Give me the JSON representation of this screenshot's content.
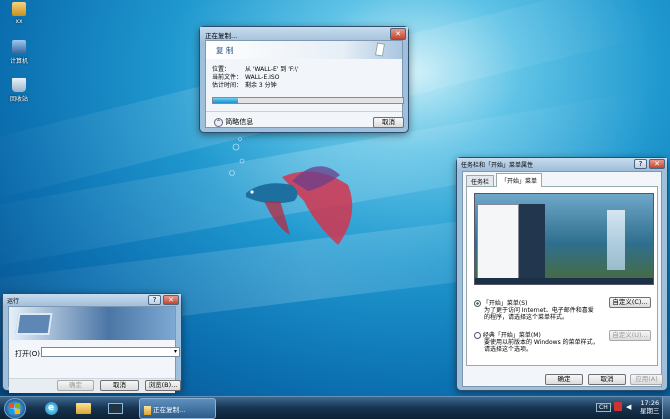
{
  "desktop": {
    "icons": [
      {
        "label": "xx"
      },
      {
        "label": "计算机"
      },
      {
        "label": "回收站"
      }
    ]
  },
  "copy_dialog": {
    "title": "正在复制...",
    "header": "复 制",
    "rows": [
      {
        "label": "位置：",
        "value": "从 'WALL-E' 到 'F:\\'"
      },
      {
        "label": "当前文件：",
        "value": "WALL-E.ISO"
      },
      {
        "label": "估计时间：",
        "value": "剩余 3 分钟"
      }
    ],
    "progress": 0.13,
    "details_label": "简略信息",
    "cancel_label": "取消"
  },
  "run_dialog": {
    "title": "运行",
    "open_label": "打开(O)：",
    "open_value": "",
    "ok_label": "确定",
    "cancel_label": "取消",
    "browse_label": "浏览(B)..."
  },
  "taskbar_props": {
    "title": "任务栏和「开始」菜单属性",
    "tabs": [
      {
        "label": "任务栏"
      },
      {
        "label": "「开始」菜单"
      }
    ],
    "option1": {
      "label": "「开始」菜单(S)",
      "desc1": "为了更于访问 Internet、电子邮件和喜爱",
      "desc2": "的程序，请选择这个菜单样式。",
      "customize": "自定义(C)..."
    },
    "option2": {
      "label": "经典「开始」菜单(M)",
      "desc1": "要使用以前版本的 Windows 的菜单样式，",
      "desc2": "请选择这个选项。",
      "customize": "自定义(U)..."
    },
    "ok_label": "确定",
    "cancel_label": "取消",
    "apply_label": "应用(A)"
  },
  "taskbar": {
    "task_label": "正在复制...",
    "time": "17:26",
    "day": "星期三",
    "lang": "CH"
  },
  "colors": {
    "accent": "#1f98cf",
    "taskbar": "#16334f"
  }
}
